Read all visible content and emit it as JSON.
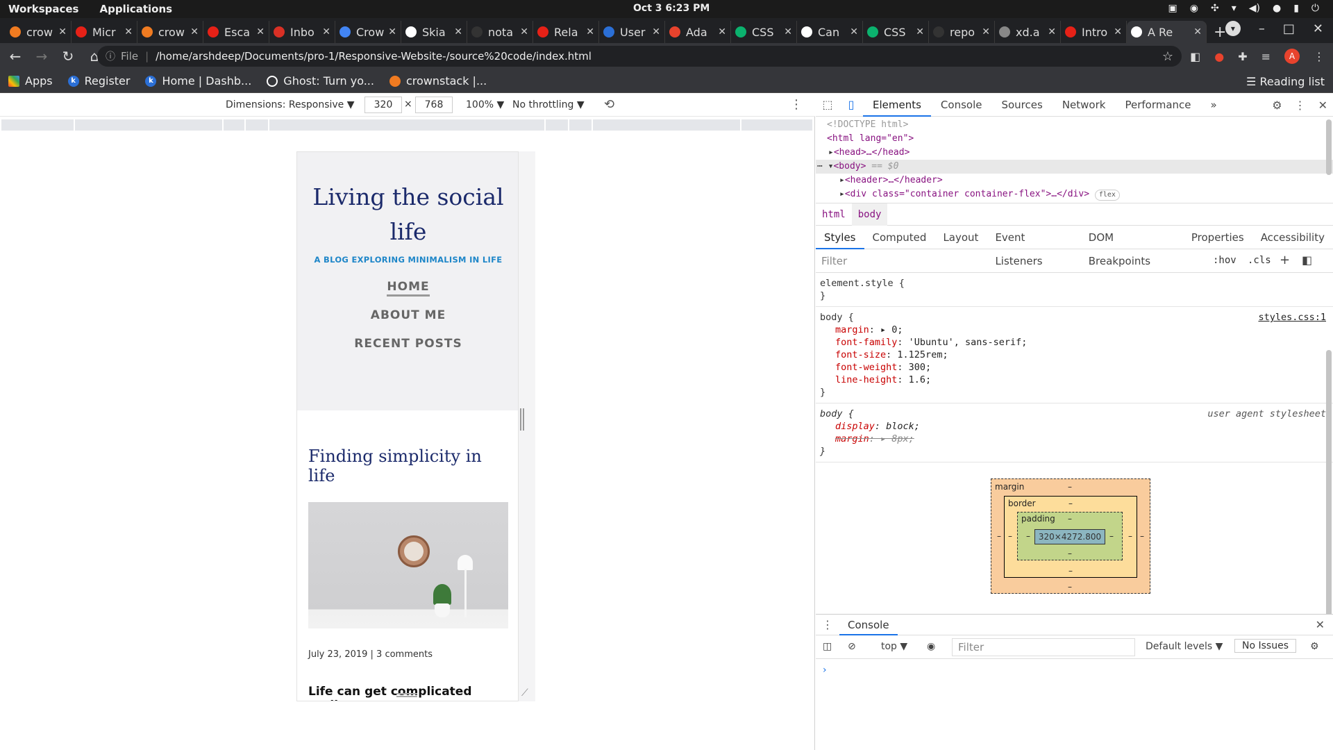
{
  "os": {
    "workspaces": "Workspaces",
    "applications": "Applications",
    "clock": "Oct 3   6:23 PM"
  },
  "tabs": [
    {
      "label": "crow",
      "color": "#f07b21"
    },
    {
      "label": "Micr",
      "color": "#e62117"
    },
    {
      "label": "crow",
      "color": "#f07b21"
    },
    {
      "label": "Esca",
      "color": "#e62117"
    },
    {
      "label": "Inbo",
      "color": "#d93025"
    },
    {
      "label": "Crow",
      "color": "#4285f4"
    },
    {
      "label": "Skia",
      "color": "#ffffff"
    },
    {
      "label": "nota",
      "color": "#333333"
    },
    {
      "label": "Rela",
      "color": "#e62117"
    },
    {
      "label": "User",
      "color": "#2b6fd6"
    },
    {
      "label": "Ada",
      "color": "#e8432d"
    },
    {
      "label": "CSS",
      "color": "#0bb26e"
    },
    {
      "label": "Can",
      "color": "#ffffff"
    },
    {
      "label": "CSS",
      "color": "#0bb26e"
    },
    {
      "label": "repo",
      "color": "#333333"
    },
    {
      "label": "xd.a",
      "color": "#888888"
    },
    {
      "label": "Intro",
      "color": "#e62117"
    },
    {
      "label": "A Re",
      "color": "#ffffff",
      "active": true
    }
  ],
  "address": {
    "file_label": "File",
    "url": "/home/arshdeep/Documents/pro-1/Responsive-Website-/source%20code/index.html",
    "avatar": "A"
  },
  "bookmarks": {
    "apps": "Apps",
    "items": [
      "Register",
      "Home | Dashb...",
      "Ghost: Turn yo...",
      "crownstack |..."
    ],
    "reading_list": "Reading list"
  },
  "device_toolbar": {
    "dimensions": "Dimensions: Responsive ▼",
    "width": "320",
    "height": "768",
    "x": "×",
    "zoom": "100% ▼",
    "throttle": "No throttling ▼"
  },
  "site": {
    "title": "Living the social life",
    "tagline": "A BLOG EXPLORING MINIMALISM IN LIFE",
    "nav": [
      "HOME",
      "ABOUT ME",
      "RECENT POSTS"
    ],
    "post_title": "Finding simplicity in life",
    "post_meta": "July 23, 2019 | 3 comments",
    "post_lead": "Life can get complicated really"
  },
  "devtools": {
    "tabs": [
      "Elements",
      "Console",
      "Sources",
      "Network",
      "Performance"
    ],
    "more": "»",
    "dom": {
      "doctype": "<!DOCTYPE html>",
      "html_open": "<html lang=\"en\">",
      "head": "<head>…</head>",
      "body": "<body>",
      "body_eq": "== $0",
      "header": "<header>…</header>",
      "div_open": "<div class=\"container container-flex\">…</div>",
      "flex": "flex"
    },
    "crumbs": [
      "html",
      "body"
    ],
    "subtabs": [
      "Styles",
      "Computed",
      "Layout",
      "Event Listeners",
      "DOM Breakpoints",
      "Properties",
      "Accessibility"
    ],
    "filter_placeholder": "Filter",
    "hov": ":hov",
    "cls": ".cls",
    "rules": {
      "element_style": "element.style {",
      "close": "}",
      "body_sel": "body {",
      "source": "styles.css:1",
      "ua_source": "user agent stylesheet",
      "props": [
        {
          "name": "margin",
          "value": "▸ 0;"
        },
        {
          "name": "font-family",
          "value": "'Ubuntu', sans-serif;"
        },
        {
          "name": "font-size",
          "value": "1.125rem;"
        },
        {
          "name": "font-weight",
          "value": "300;"
        },
        {
          "name": "line-height",
          "value": "1.6;"
        }
      ],
      "ua_props": [
        {
          "name": "display",
          "value": "block;"
        },
        {
          "name": "margin",
          "value": "▸ 8px;"
        }
      ]
    },
    "box_model": {
      "margin": "margin",
      "border": "border",
      "padding": "padding",
      "content": "320×4272.800",
      "dash": "–"
    },
    "console": {
      "tab": "Console",
      "context": "top ▼",
      "filter": "Filter",
      "levels": "Default levels ▼",
      "issues": "No Issues",
      "prompt": "›"
    }
  }
}
